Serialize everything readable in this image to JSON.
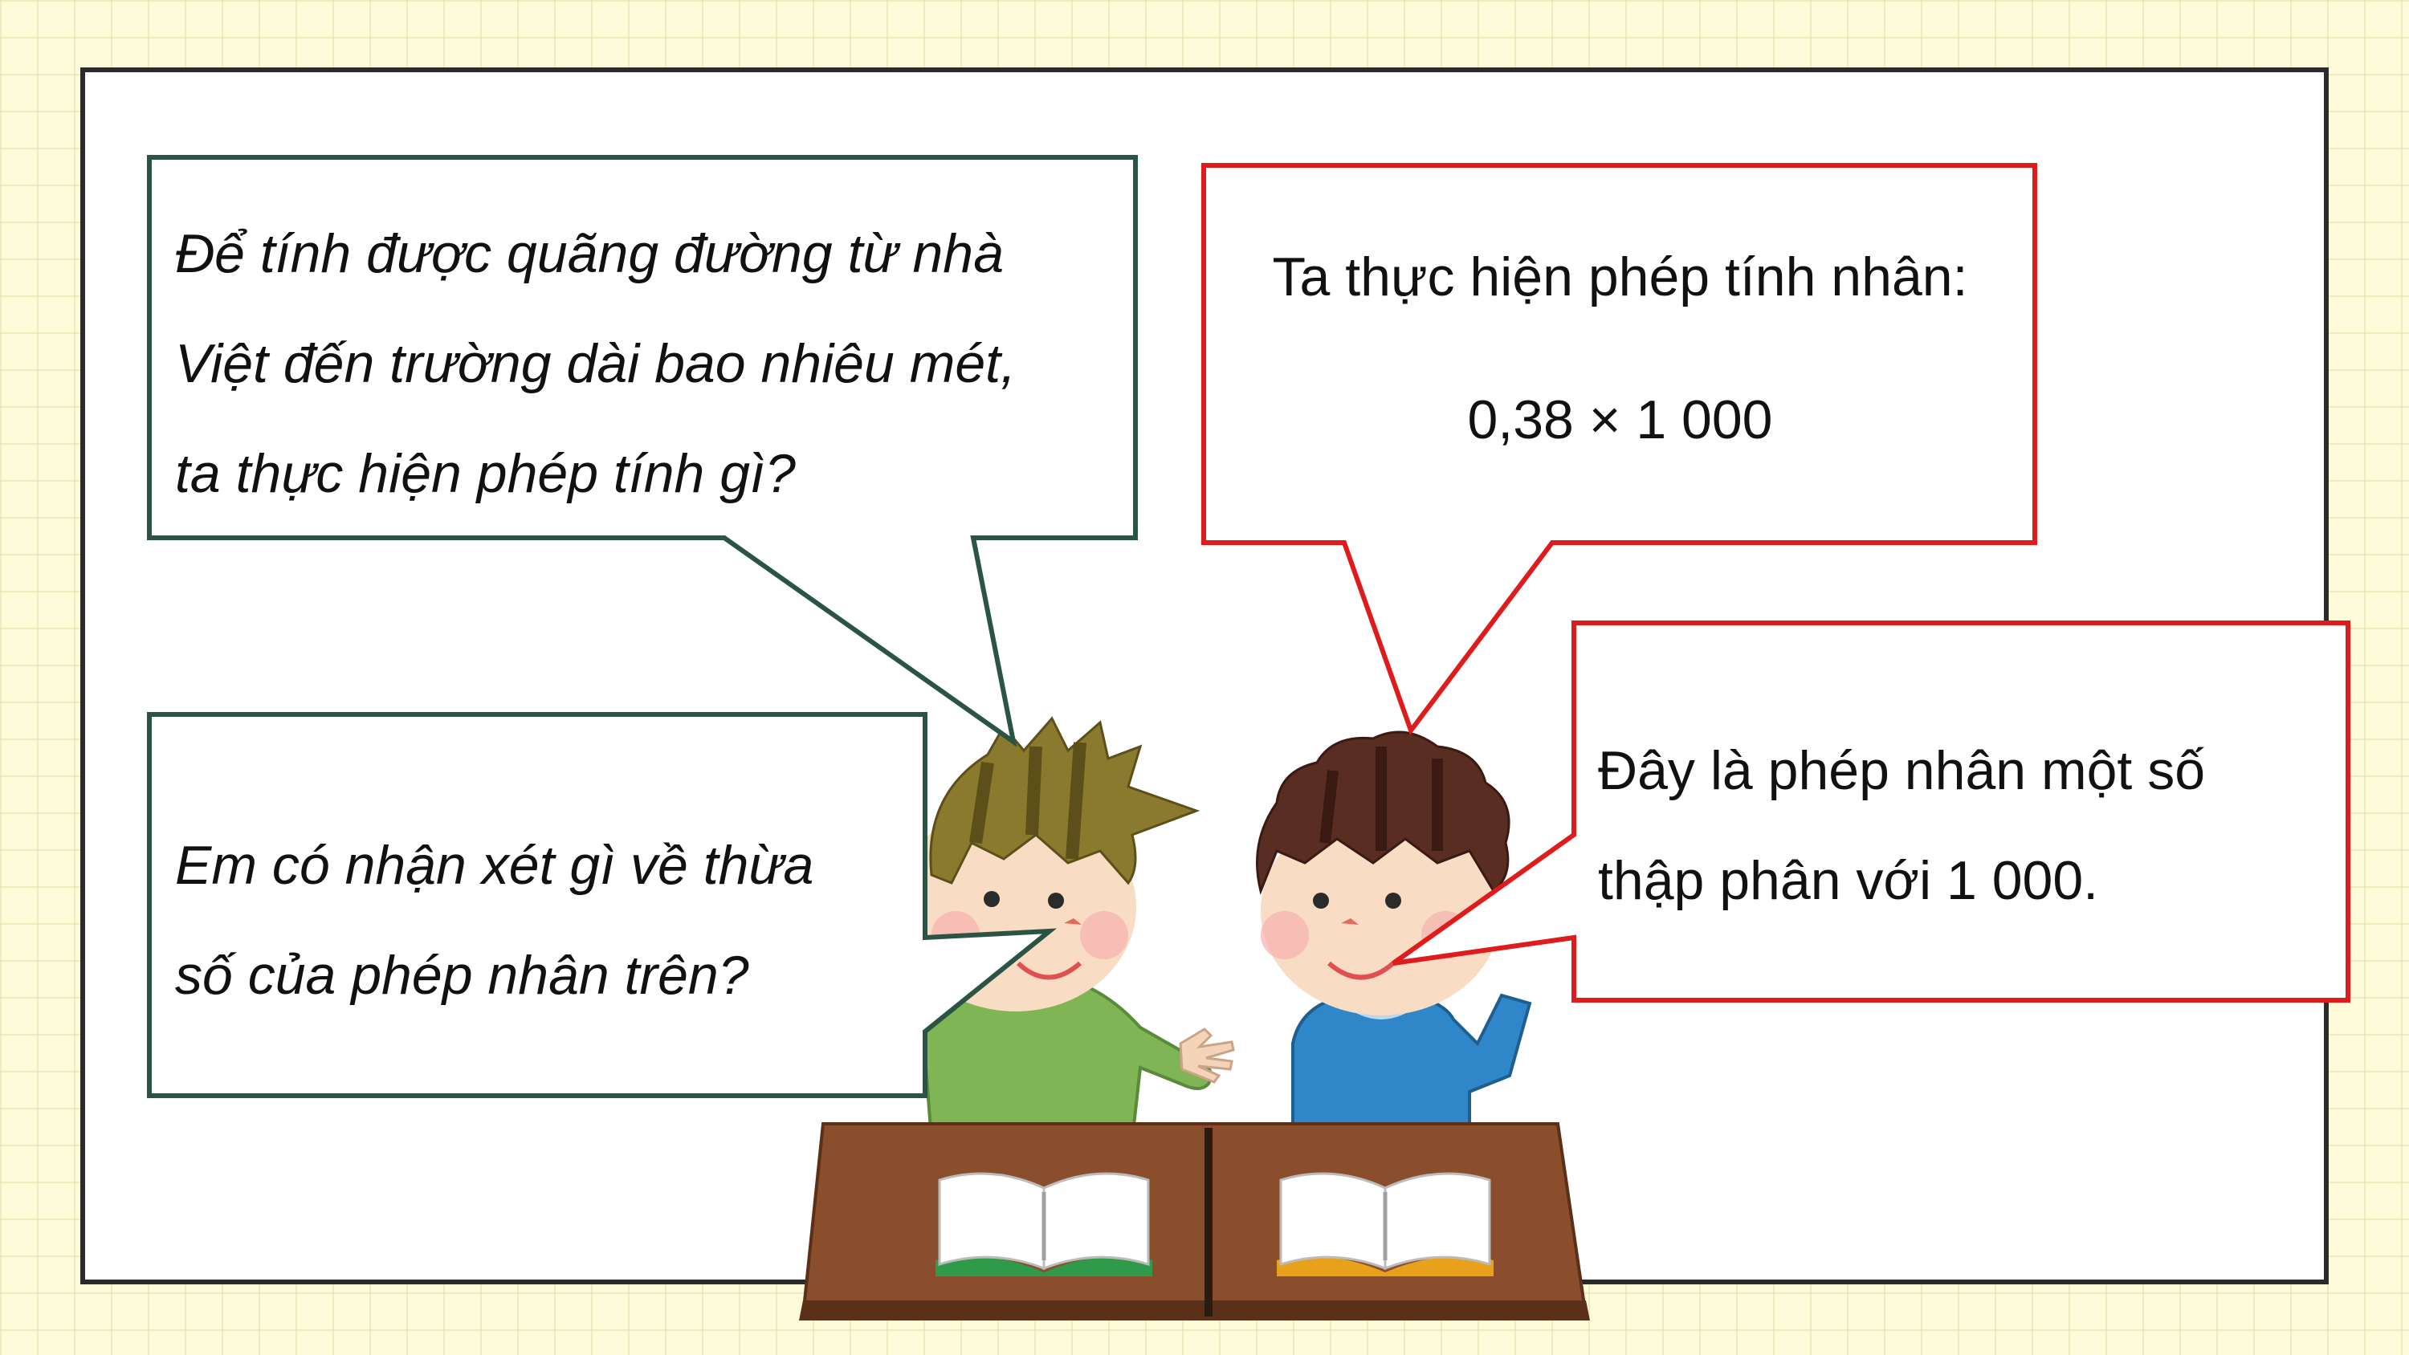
{
  "bubble_question_1": {
    "lines": [
      "Để tính được quãng đường từ nhà",
      "Việt đến trường dài bao nhiêu mét,",
      "ta thực hiện phép tính gì?"
    ],
    "border_color": "#2b5445"
  },
  "bubble_question_2": {
    "lines": [
      "Em có nhận xét gì về thừa",
      "số của phép nhân trên?"
    ],
    "border_color": "#2b5445"
  },
  "bubble_answer_1": {
    "line1": "Ta thực hiện phép tính nhân:",
    "expression": "0,38 × 1 000",
    "border_color": "#e01b1b"
  },
  "bubble_answer_2": {
    "lines": [
      "Đây là phép nhân một số",
      "thập phân với 1 000."
    ],
    "border_color": "#e01b1b"
  },
  "illustration": {
    "left_child_shirt": "#7fb554",
    "right_child_shirt": "#2f86c8",
    "desk_color": "#8a4e2c",
    "icon": "two-children-at-desk-illustration"
  }
}
